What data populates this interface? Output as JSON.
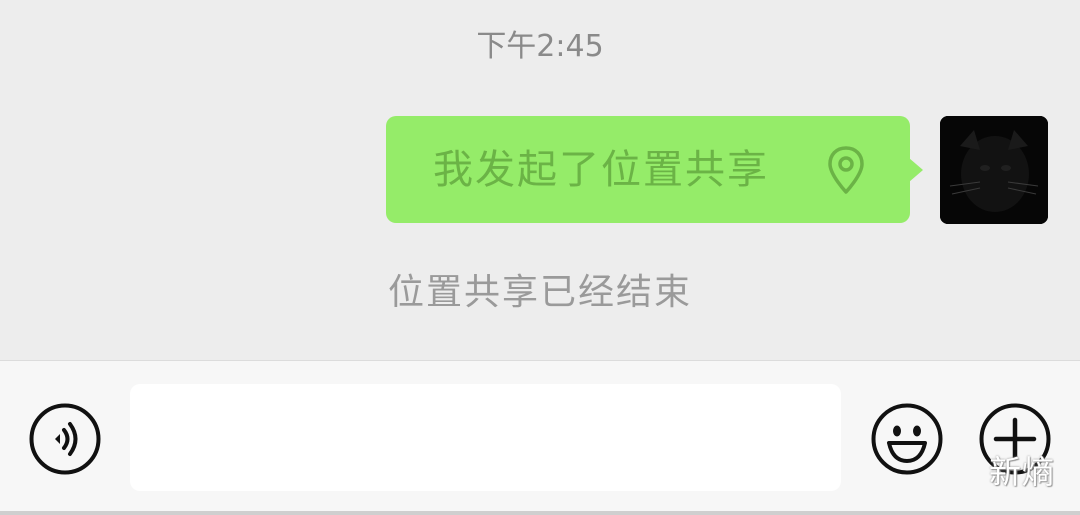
{
  "chat": {
    "timestamp": "下午2:45",
    "message": {
      "text": "我发起了位置共享",
      "icon": "location-pin-icon",
      "bubble_color": "#95ec69",
      "text_color": "#6bb346"
    },
    "system_message": "位置共享已经结束"
  },
  "input_bar": {
    "voice_icon": "voice-icon",
    "input_value": "",
    "emoji_icon": "emoji-icon",
    "plus_icon": "plus-icon"
  },
  "watermark": "新熵"
}
